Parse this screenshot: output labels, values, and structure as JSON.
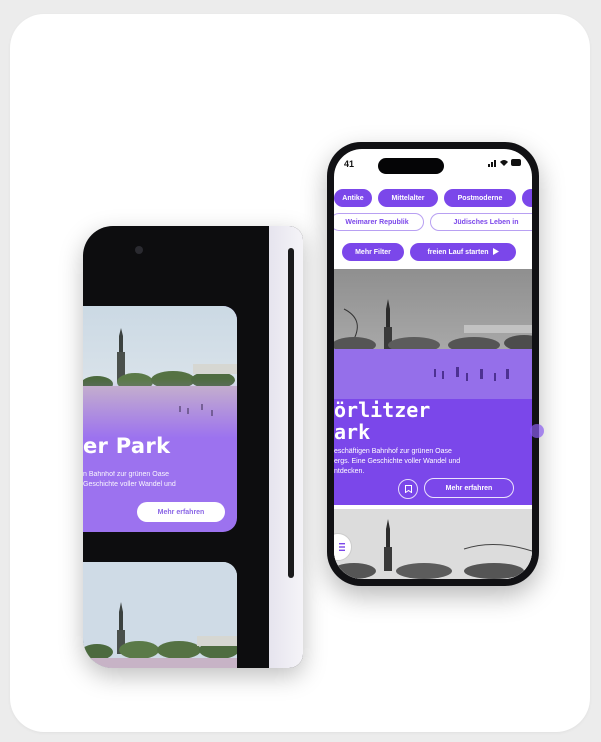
{
  "left_phone": {
    "card_title": "er Park",
    "card_desc_line1": "n Bahnhof zur grünen Oase",
    "card_desc_line2": "Geschichte voller Wandel und",
    "more_button": "Mehr erfahren"
  },
  "right_phone": {
    "status_time": "41",
    "chips_row1": [
      "Antike",
      "Mittelalter",
      "Postmoderne"
    ],
    "chips_row2": [
      "Weimarer Republik",
      "Jüdisches Leben in"
    ],
    "filter_button": "Mehr Filter",
    "free_run_button": "freien Lauf starten",
    "hero_title_line1": "örlitzer",
    "hero_title_line2": "ark",
    "hero_desc_line1": "eschäftigen Bahnhof zur grünen Oase",
    "hero_desc_line2": "ergs. Eine Geschichte voller Wandel und",
    "hero_desc_line3": "ntdecken.",
    "more_button": "Mehr erfahren"
  },
  "colors": {
    "accent": "#7b47ea",
    "accent_light": "#9c72ef",
    "card_bg": "#ffffff",
    "page_bg": "#ececec"
  }
}
